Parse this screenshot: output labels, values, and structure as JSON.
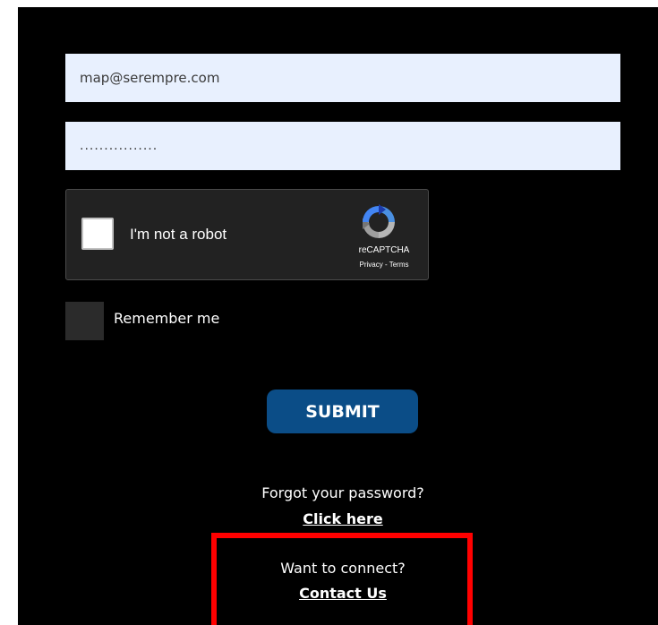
{
  "form": {
    "email_value": "map@serempre.com",
    "password_value": "................"
  },
  "recaptcha": {
    "label": "I'm not a robot",
    "brand": "reCAPTCHA",
    "privacy": "Privacy",
    "separator": " - ",
    "terms": "Terms",
    "icon": "recaptcha-logo-icon"
  },
  "remember": {
    "label": "Remember me",
    "checked": false
  },
  "submit": {
    "label": "SUBMIT"
  },
  "forgot": {
    "prompt": "Forgot your password?",
    "link": "Click here"
  },
  "connect": {
    "prompt": "Want to connect?",
    "link": "Contact Us"
  },
  "colors": {
    "background": "#000000",
    "input_bg": "#e8f0fe",
    "submit_bg": "#0b4d87",
    "highlight": "#ff0000"
  }
}
